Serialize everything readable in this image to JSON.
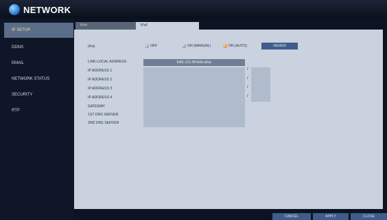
{
  "window": {
    "title": "NETWORK"
  },
  "sidebar": {
    "items": [
      {
        "label": "IP SETUP"
      },
      {
        "label": "DDNS"
      },
      {
        "label": "EMAIL"
      },
      {
        "label": "NETWORK STATUS"
      },
      {
        "label": "SECURITY"
      },
      {
        "label": "RTP"
      }
    ],
    "active_index": 0
  },
  "tabs": [
    {
      "label": "IPv4"
    },
    {
      "label": "IPv6"
    }
  ],
  "active_tab": "IPv6",
  "ipv6": {
    "label": "IPv6",
    "options": [
      {
        "label": "OFF"
      },
      {
        "label": "ON (MANUAL)"
      },
      {
        "label": "ON (AUTO)"
      }
    ],
    "selected_option": "ON (AUTO)",
    "renew_label": "RENEW"
  },
  "fields": {
    "link_local_label": "LINK-LOCAL ADDRESS",
    "link_local_value": "fe80::211:5ff:fe0b:a5ac",
    "ip1_label": "IP ADDRESS 1",
    "ip2_label": "IP ADDRESS 2",
    "ip3_label": "IP ADDRESS 3",
    "ip4_label": "IP ADDRESS 4",
    "gateway_label": "GATEWAY",
    "dns1_label": "1ST DNS SERVER",
    "dns2_label": "2ND DNS SERVER",
    "prefix_separator": "/"
  },
  "footer": {
    "cancel_label": "CANCEL",
    "apply_label": "APPLY",
    "close_label": "CLOSE"
  },
  "colors": {
    "accent": "#3e5d8a",
    "selected_radio": "#e06a0c"
  }
}
